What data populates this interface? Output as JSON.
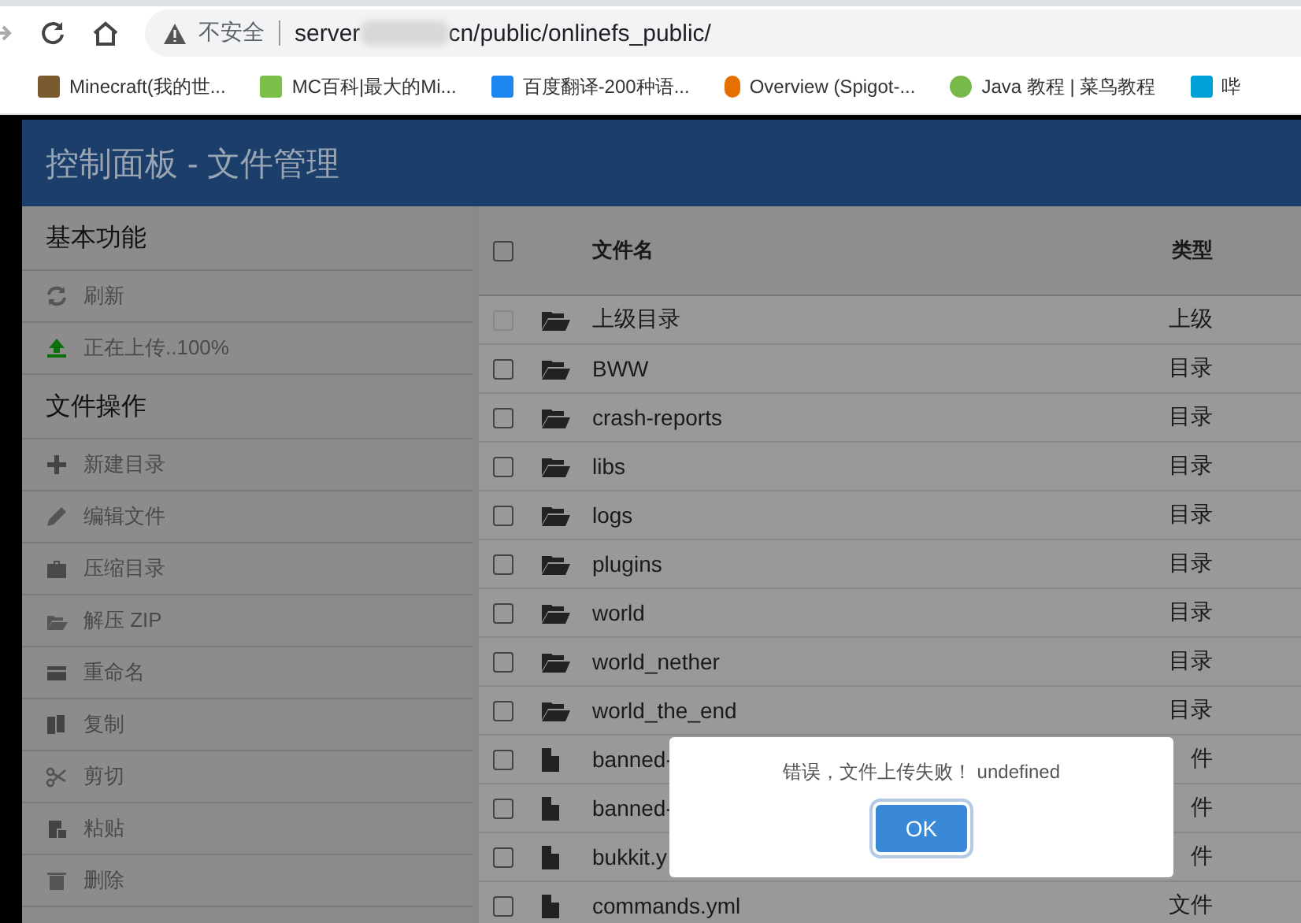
{
  "browser": {
    "security_label": "不安全",
    "url_start": "server",
    "url_end": "cn/public/onlinefs_public/",
    "bookmarks": [
      "Minecraft(我的世...",
      "MC百科|最大的Mi...",
      "百度翻译-200种语...",
      "Overview (Spigot-...",
      "Java 教程 | 菜鸟教程",
      "哔"
    ]
  },
  "app": {
    "title": "控制面板 - 文件管理"
  },
  "sidebar": {
    "sections": [
      {
        "title": "基本功能",
        "items": [
          {
            "label": "刷新"
          },
          {
            "label": "正在上传..100%"
          }
        ]
      },
      {
        "title": "文件操作",
        "items": [
          {
            "label": "新建目录"
          },
          {
            "label": "编辑文件"
          },
          {
            "label": "压缩目录"
          },
          {
            "label": "解压 ZIP"
          },
          {
            "label": "重命名"
          },
          {
            "label": "复制"
          },
          {
            "label": "剪切"
          },
          {
            "label": "粘贴"
          },
          {
            "label": "删除"
          }
        ]
      }
    ]
  },
  "table": {
    "select_all_checked": false,
    "columns": [
      "文件名",
      "类型"
    ],
    "rows": [
      {
        "kind": "folder",
        "name": "上级目录",
        "type": "上级",
        "checked": false,
        "disabled": true
      },
      {
        "kind": "folder",
        "name": "BWW",
        "type": "目录",
        "checked": false,
        "disabled": false
      },
      {
        "kind": "folder",
        "name": "crash-reports",
        "type": "目录",
        "checked": false,
        "disabled": false
      },
      {
        "kind": "folder",
        "name": "libs",
        "type": "目录",
        "checked": false,
        "disabled": false
      },
      {
        "kind": "folder",
        "name": "logs",
        "type": "目录",
        "checked": false,
        "disabled": false
      },
      {
        "kind": "folder",
        "name": "plugins",
        "type": "目录",
        "checked": false,
        "disabled": false
      },
      {
        "kind": "folder",
        "name": "world",
        "type": "目录",
        "checked": false,
        "disabled": false
      },
      {
        "kind": "folder",
        "name": "world_nether",
        "type": "目录",
        "checked": false,
        "disabled": false
      },
      {
        "kind": "folder",
        "name": "world_the_end",
        "type": "目录",
        "checked": false,
        "disabled": false
      },
      {
        "kind": "file",
        "name": "banned-",
        "type": "件",
        "checked": false,
        "disabled": false
      },
      {
        "kind": "file",
        "name": "banned-",
        "type": "件",
        "checked": false,
        "disabled": false
      },
      {
        "kind": "file",
        "name": "bukkit.y",
        "type": "件",
        "checked": false,
        "disabled": false
      },
      {
        "kind": "file",
        "name": "commands.yml",
        "type": "文件",
        "checked": false,
        "disabled": false
      }
    ]
  },
  "dialog": {
    "message": "错误，文件上传失败！ undefined",
    "button": "OK"
  }
}
